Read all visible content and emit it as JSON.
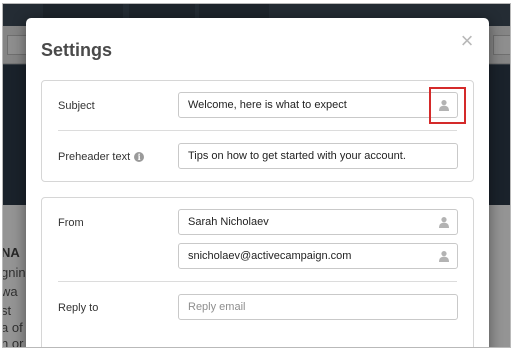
{
  "modal": {
    "title": "Settings",
    "close_glyph": "×"
  },
  "fields": {
    "subject": {
      "label": "Subject",
      "value": "Welcome, here is what to expect",
      "icon": "person-icon"
    },
    "preheader": {
      "label": "Preheader text",
      "info_glyph": "i",
      "value": "Tips on how to get started with your account."
    },
    "from_name": {
      "label": "From",
      "value": "Sarah Nicholaev",
      "icon": "person-icon"
    },
    "from_email": {
      "value": "snicholaev@activecampaign.com",
      "icon": "person-icon"
    },
    "reply_to": {
      "label": "Reply to",
      "placeholder": "Reply email"
    }
  },
  "background": {
    "fragments": [
      "NA",
      "gnin",
      "wa",
      "st",
      "a of",
      "n or",
      "ns"
    ]
  },
  "colors": {
    "highlight": "#d42a2a",
    "overlay": "rgba(0,0,0,0.42)"
  }
}
